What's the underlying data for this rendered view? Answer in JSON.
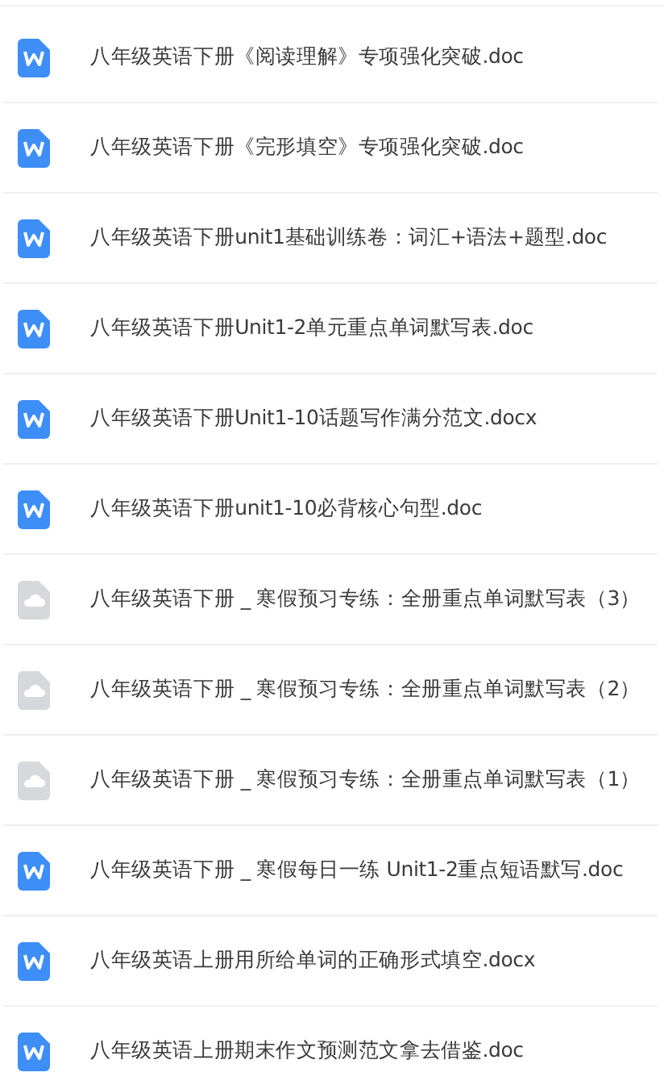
{
  "files": [
    {
      "kind": "word",
      "name": "八年级英语下册《阅读理解》专项强化突破.doc"
    },
    {
      "kind": "word",
      "name": "八年级英语下册《完形填空》专项强化突破.doc"
    },
    {
      "kind": "word",
      "name": "八年级英语下册unit1基础训练卷：词汇+语法+题型.doc"
    },
    {
      "kind": "word",
      "name": "八年级英语下册Unit1-2单元重点单词默写表.doc"
    },
    {
      "kind": "word",
      "name": "八年级英语下册Unit1-10话题写作满分范文.docx"
    },
    {
      "kind": "word",
      "name": "八年级英语下册unit1-10必背核心句型.doc"
    },
    {
      "kind": "cloud",
      "name": "八年级英语下册 _ 寒假预习专练：全册重点单词默写表（3）"
    },
    {
      "kind": "cloud",
      "name": "八年级英语下册 _ 寒假预习专练：全册重点单词默写表（2）"
    },
    {
      "kind": "cloud",
      "name": "八年级英语下册 _ 寒假预习专练：全册重点单词默写表（1）"
    },
    {
      "kind": "word",
      "name": "八年级英语下册 _ 寒假每日一练 Unit1-2重点短语默写.doc"
    },
    {
      "kind": "word",
      "name": "八年级英语上册用所给单词的正确形式填空.docx"
    },
    {
      "kind": "word",
      "name": "八年级英语上册期末作文预测范文拿去借鉴.doc"
    }
  ]
}
